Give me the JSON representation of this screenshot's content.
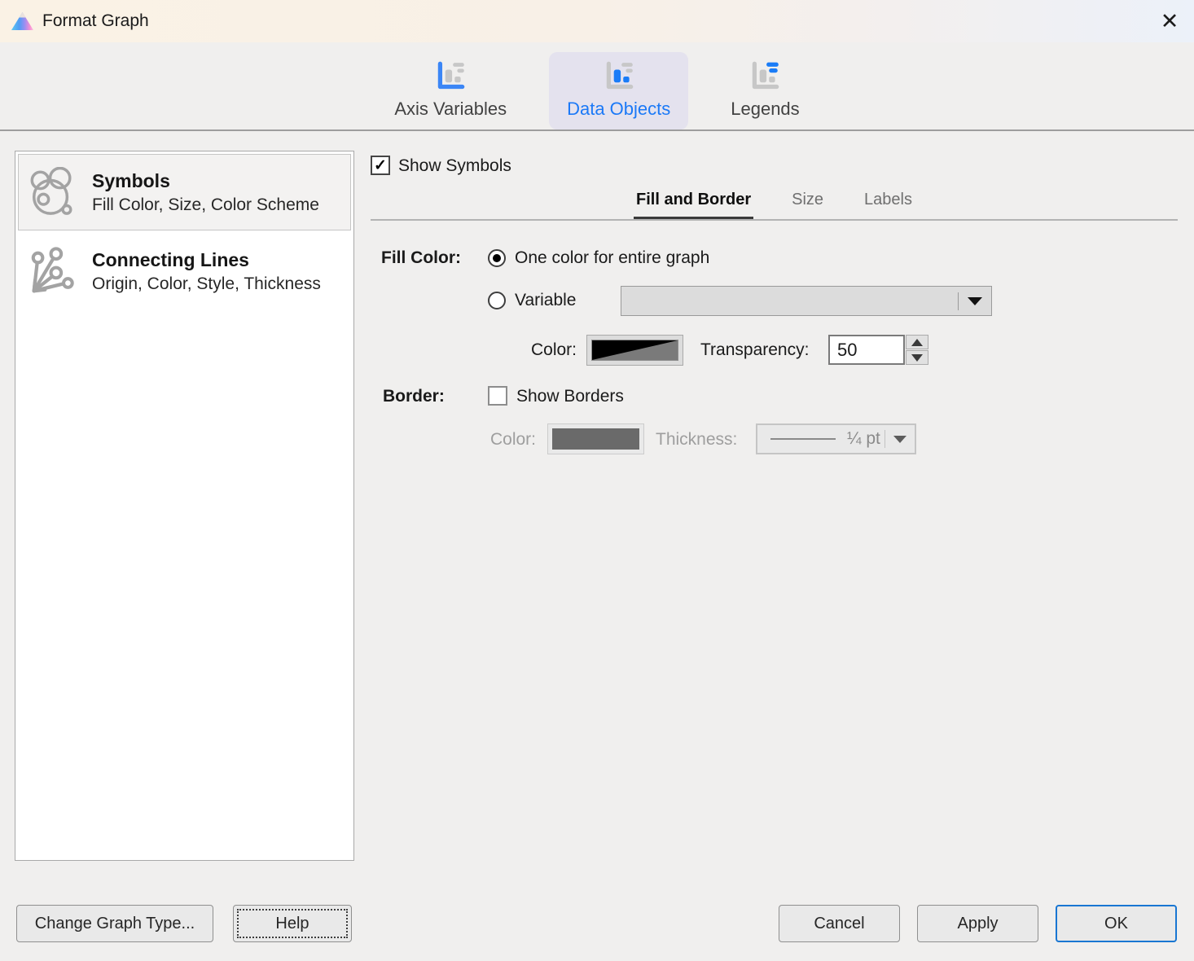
{
  "window": {
    "title": "Format Graph"
  },
  "icons": {
    "close": "✕",
    "checkmark": "✓"
  },
  "nav": {
    "tabs": [
      {
        "label": "Axis Variables",
        "selected": false
      },
      {
        "label": "Data Objects",
        "selected": true
      },
      {
        "label": "Legends",
        "selected": false
      }
    ]
  },
  "sidebar": {
    "items": [
      {
        "title": "Symbols",
        "subtitle": "Fill Color, Size, Color Scheme",
        "selected": true
      },
      {
        "title": "Connecting Lines",
        "subtitle": "Origin, Color, Style, Thickness",
        "selected": false
      }
    ]
  },
  "panel": {
    "show_symbols": {
      "label": "Show Symbols",
      "checked": true
    },
    "tabs": [
      {
        "label": "Fill and Border",
        "active": true
      },
      {
        "label": "Size",
        "active": false
      },
      {
        "label": "Labels",
        "active": false
      }
    ],
    "fill": {
      "section_label": "Fill Color:",
      "one_color_label": "One color for entire graph",
      "one_color_selected": true,
      "variable_label": "Variable",
      "variable_selected": false,
      "variable_value": "",
      "color_label": "Color:",
      "transparency_label": "Transparency:",
      "transparency_value": "50"
    },
    "border": {
      "section_label": "Border:",
      "show_borders_label": "Show Borders",
      "show_borders_checked": false,
      "color_label": "Color:",
      "thickness_label": "Thickness:",
      "thickness_value": "¼ pt"
    }
  },
  "footer": {
    "change_graph_type": "Change Graph Type...",
    "help": "Help",
    "cancel": "Cancel",
    "apply": "Apply",
    "ok": "OK"
  },
  "colors": {
    "accent_blue": "#1b79f7",
    "nav_selected_bg": "#e4e2ee",
    "titlebar_left": "#faf2e5",
    "titlebar_right": "#ecf1f9",
    "fill_swatch_black": "#000000",
    "fill_swatch_gray": "#7a7a7a",
    "border_swatch_gray": "#6a6a6a",
    "ok_border_blue": "#1976d2"
  }
}
